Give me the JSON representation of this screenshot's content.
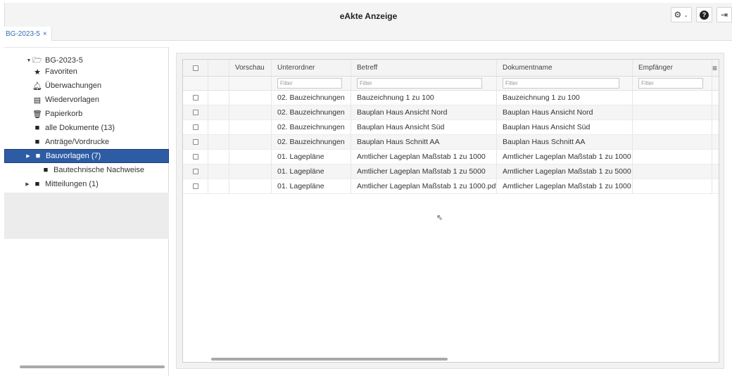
{
  "app": {
    "title": "eAkte Anzeige"
  },
  "top_actions": {
    "settings_icon": "gear-icon",
    "settings_caret": "⌄",
    "help_icon": "help-icon",
    "logout_icon": "logout-icon"
  },
  "tabs": [
    {
      "label": "BG-2023-5",
      "close": "×"
    }
  ],
  "tree": {
    "root": {
      "label": "BG-2023-5",
      "icon": "folder-open-icon"
    },
    "items": [
      {
        "label": "Favoriten",
        "icon": "star-icon"
      },
      {
        "label": "Überwachungen",
        "icon": "bell-icon"
      },
      {
        "label": "Wiedervorlagen",
        "icon": "calendar-icon"
      },
      {
        "label": "Papierkorb",
        "icon": "trash-icon"
      },
      {
        "label": "alle Dokumente (13)",
        "icon": "folder-icon"
      },
      {
        "label": "Anträge/Vordrucke",
        "icon": "folder-icon"
      },
      {
        "label": "Bauvorlagen (7)",
        "icon": "folder-icon",
        "selected": true
      },
      {
        "label": "Bautechnische Nachweise",
        "icon": "folder-icon"
      },
      {
        "label": "Mitteilungen (1)",
        "icon": "folder-icon"
      }
    ]
  },
  "grid": {
    "columns": [
      "",
      "",
      "Vorschau",
      "Unterordner",
      "Betreff",
      "Dokumentname",
      "Empfänger"
    ],
    "filter_placeholder": "Filter",
    "rows": [
      {
        "unterordner": "02. Bauzeichnungen",
        "betreff": "Bauzeichnung 1 zu 100",
        "dokumentname": "Bauzeichnung 1 zu 100",
        "empfaenger": ""
      },
      {
        "unterordner": "02. Bauzeichnungen",
        "betreff": "Bauplan Haus Ansicht Nord",
        "dokumentname": "Bauplan Haus Ansicht Nord",
        "empfaenger": ""
      },
      {
        "unterordner": "02. Bauzeichnungen",
        "betreff": "Bauplan Haus Ansicht Süd",
        "dokumentname": "Bauplan Haus Ansicht Süd",
        "empfaenger": ""
      },
      {
        "unterordner": "02. Bauzeichnungen",
        "betreff": "Bauplan Haus Schnitt AA",
        "dokumentname": "Bauplan Haus Schnitt AA",
        "empfaenger": ""
      },
      {
        "unterordner": "01. Lagepläne",
        "betreff": "Amtlicher Lageplan Maßstab 1 zu 1000",
        "dokumentname": "Amtlicher Lageplan Maßstab 1 zu 1000",
        "empfaenger": ""
      },
      {
        "unterordner": "01. Lagepläne",
        "betreff": "Amtlicher Lageplan Maßstab 1 zu 5000",
        "dokumentname": "Amtlicher Lageplan Maßstab 1 zu 5000",
        "empfaenger": ""
      },
      {
        "unterordner": "01. Lagepläne",
        "betreff": "Amtlicher Lageplan Maßstab 1 zu 1000.pdf",
        "dokumentname": "Amtlicher Lageplan Maßstab 1 zu 1000",
        "empfaenger": ""
      }
    ]
  },
  "colors": {
    "accent": "#2e5ca4",
    "link": "#2f6fb5"
  }
}
